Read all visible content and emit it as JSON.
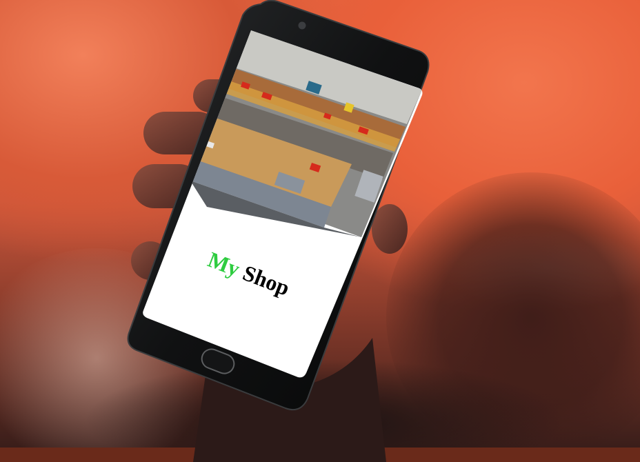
{
  "scene": {
    "description_visible": "",
    "phone_screen": {
      "header_image_icon": "workshop-photo",
      "title_part1": "My",
      "title_part2": "Shop"
    }
  },
  "colors": {
    "background_accent": "#e9603a",
    "title_accent": "#2ecc40",
    "title_main": "#000000",
    "screen_background": "#ffffff",
    "phone_body": "#0f1011"
  }
}
